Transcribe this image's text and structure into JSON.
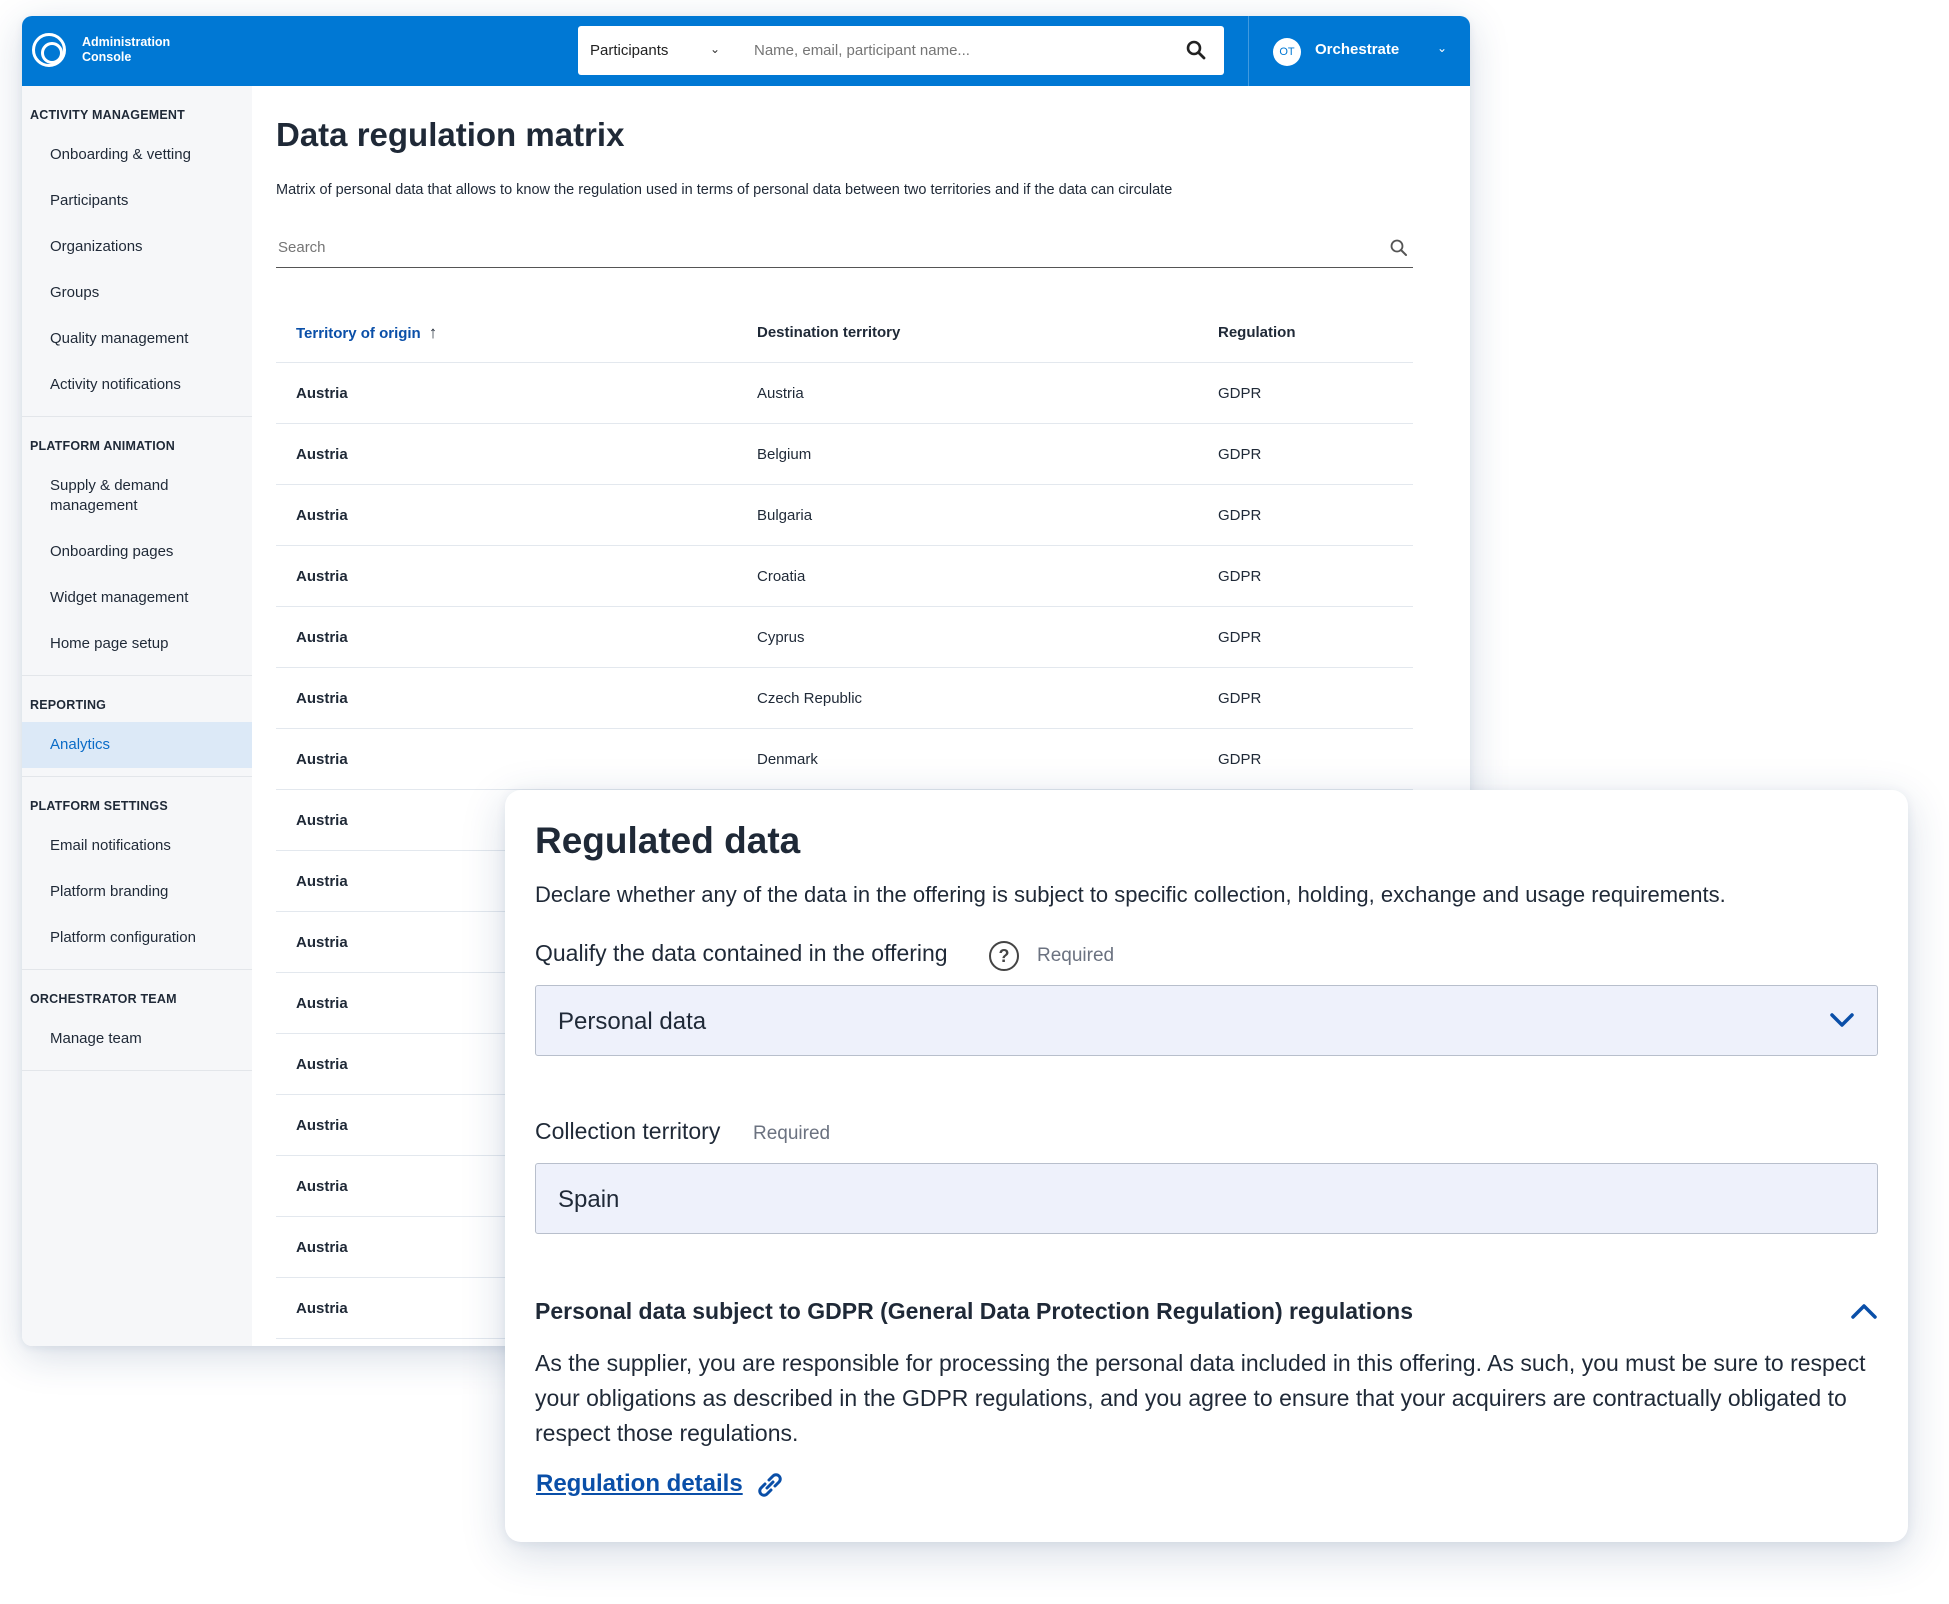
{
  "app": {
    "logo_line1": "Administration",
    "logo_line2": "Console",
    "accent": "#0078d4"
  },
  "search": {
    "scope": "Participants",
    "placeholder": "Name, email, participant name..."
  },
  "user": {
    "initials": "OT",
    "name": "Orchestrate"
  },
  "sidebar": {
    "sections": [
      {
        "heading": "ACTIVITY MANAGEMENT",
        "items": [
          "Onboarding & vetting",
          "Participants",
          "Organizations",
          "Groups",
          "Quality management",
          "Activity notifications"
        ]
      },
      {
        "heading": "PLATFORM ANIMATION",
        "items": [
          "Supply & demand management",
          "Onboarding pages",
          "Widget management",
          "Home page setup"
        ]
      },
      {
        "heading": "REPORTING",
        "items": [
          "Analytics"
        ]
      },
      {
        "heading": "PLATFORM SETTINGS",
        "items": [
          "Email notifications",
          "Platform branding",
          "Platform configuration"
        ]
      },
      {
        "heading": "ORCHESTRATOR TEAM",
        "items": [
          "Manage team"
        ]
      }
    ],
    "active_item": "Analytics"
  },
  "page": {
    "title": "Data regulation matrix",
    "description": "Matrix of personal data that allows to know the regulation used in terms of personal data between two territories and if the data can circulate",
    "search_placeholder": "Search"
  },
  "table": {
    "columns": [
      "Territory of origin",
      "Destination territory",
      "Regulation"
    ],
    "sort_indicator": "↑",
    "rows": [
      [
        "Austria",
        "Austria",
        "GDPR"
      ],
      [
        "Austria",
        "Belgium",
        "GDPR"
      ],
      [
        "Austria",
        "Bulgaria",
        "GDPR"
      ],
      [
        "Austria",
        "Croatia",
        "GDPR"
      ],
      [
        "Austria",
        "Cyprus",
        "GDPR"
      ],
      [
        "Austria",
        "Czech Republic",
        "GDPR"
      ],
      [
        "Austria",
        "Denmark",
        "GDPR"
      ],
      [
        "Austria",
        "",
        ""
      ],
      [
        "Austria",
        "",
        ""
      ],
      [
        "Austria",
        "",
        ""
      ],
      [
        "Austria",
        "",
        ""
      ],
      [
        "Austria",
        "",
        ""
      ],
      [
        "Austria",
        "",
        ""
      ],
      [
        "Austria",
        "",
        ""
      ],
      [
        "Austria",
        "",
        ""
      ],
      [
        "Austria",
        "",
        ""
      ]
    ]
  },
  "card": {
    "title": "Regulated data",
    "description": "Declare whether any of the data in the offering is subject to specific collection, holding, exchange and usage requirements.",
    "qualify_label": "Qualify the data contained in the offering",
    "help_glyph": "?",
    "required_label": "Required",
    "qualify_value": "Personal data",
    "territory_label": "Collection territory",
    "territory_value": "Spain",
    "gdpr_title": "Personal data subject to GDPR (General Data Protection Regulation) regulations",
    "gdpr_body": "As the supplier, you are responsible for processing the personal data included in this offering. As such, you must be sure to respect your obligations as described in the GDPR regulations, and you agree to ensure that your acquirers are contractually obligated to respect those regulations.",
    "link_label": "Regulation details",
    "link_color": "#0a4fa8"
  }
}
